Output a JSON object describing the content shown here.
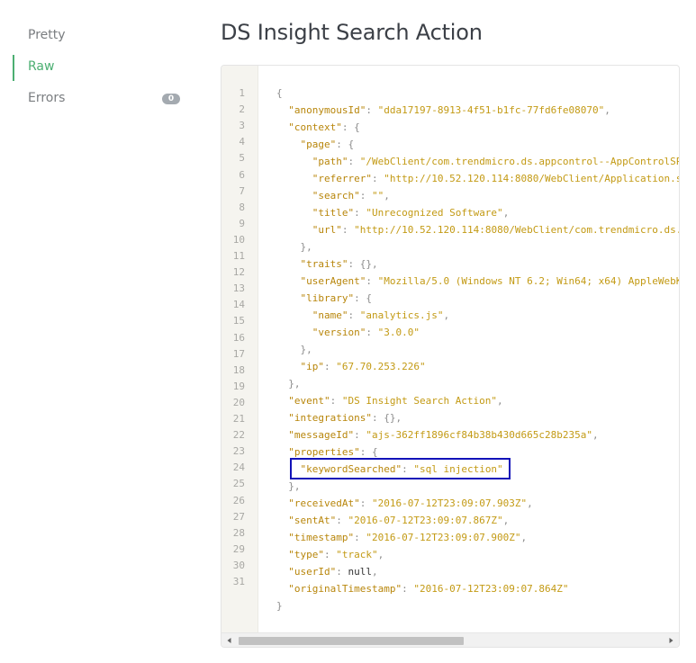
{
  "sidebar": {
    "items": [
      {
        "label": "Pretty"
      },
      {
        "label": "Raw"
      },
      {
        "label": "Errors",
        "badge": "0"
      }
    ]
  },
  "title": "DS Insight Search Action",
  "code_lines": [
    "{",
    "  \"anonymousId\": \"dda17197-8913-4f51-b1fc-77fd6fe08070\",",
    "  \"context\": {",
    "    \"page\": {",
    "      \"path\": \"/WebClient/com.trendmicro.ds.appcontrol--AppControlSP",
    "      \"referrer\": \"http://10.52.120.114:8080/WebClient/Application.s",
    "      \"search\": \"\",",
    "      \"title\": \"Unrecognized Software\",",
    "      \"url\": \"http://10.52.120.114:8080/WebClient/com.trendmicro.ds.",
    "    },",
    "    \"traits\": {},",
    "    \"userAgent\": \"Mozilla/5.0 (Windows NT 6.2; Win64; x64) AppleWebK",
    "    \"library\": {",
    "      \"name\": \"analytics.js\",",
    "      \"version\": \"3.0.0\"",
    "    },",
    "    \"ip\": \"67.70.253.226\"",
    "  },",
    "  \"event\": \"DS Insight Search Action\",",
    "  \"integrations\": {},",
    "  \"messageId\": \"ajs-362ff1896cf84b38b430d665c28b235a\",",
    "  \"properties\": {",
    "    \"keywordSearched\": \"sql injection\"",
    "  },",
    "  \"receivedAt\": \"2016-07-12T23:09:07.903Z\",",
    "  \"sentAt\": \"2016-07-12T23:09:07.867Z\",",
    "  \"timestamp\": \"2016-07-12T23:09:07.900Z\",",
    "  \"type\": \"track\",",
    "  \"userId\": null,",
    "  \"originalTimestamp\": \"2016-07-12T23:09:07.864Z\"",
    "}"
  ],
  "line_numbers": [
    "1",
    "2",
    "3",
    "4",
    "5",
    "6",
    "7",
    "8",
    "9",
    "10",
    "11",
    "12",
    "13",
    "14",
    "15",
    "16",
    "17",
    "18",
    "19",
    "20",
    "21",
    "22",
    "23",
    "24",
    "25",
    "26",
    "27",
    "28",
    "29",
    "30",
    "31"
  ],
  "colors": {
    "active_nav": "#4caf72",
    "json_key": "#b8860b",
    "json_string": "#c39a14",
    "highlight_border": "#1212b8"
  },
  "icons": {
    "scroll_left": "chevron-left-icon",
    "scroll_right": "chevron-right-icon"
  }
}
